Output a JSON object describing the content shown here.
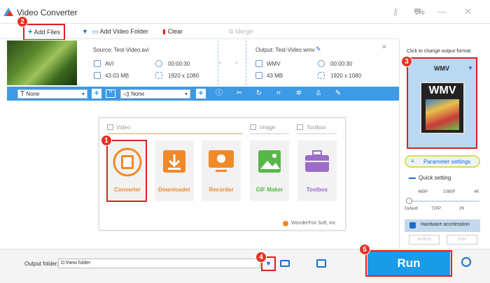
{
  "app": {
    "title": "Video Converter"
  },
  "toolbar": {
    "add_files": "Add Files",
    "add_video_folder": "Add Video Folder",
    "clear": "Clear",
    "merge": "Merge"
  },
  "file": {
    "source": "Source: Test-Video.avi",
    "output": "Output: Test-Video.wmv",
    "src_format": "AVI",
    "src_duration": "00:00:30",
    "src_size": "43.03 MB",
    "src_resolution": "1920 x 1080",
    "out_format": "WMV",
    "out_duration": "00:00:30",
    "out_size": "43 MB",
    "out_resolution": "1920 x 1080"
  },
  "edit": {
    "subtitle": "None",
    "audio": "None"
  },
  "panel": {
    "section_video": "Video",
    "section_image": "Image",
    "section_toolbox": "Toolbox",
    "cards": [
      {
        "label": "Converter",
        "icon": "film-reel-icon",
        "color": "#f0892a"
      },
      {
        "label": "Downloader",
        "icon": "download-icon",
        "color": "#f0892a"
      },
      {
        "label": "Recorder",
        "icon": "screen-record-icon",
        "color": "#f0892a"
      },
      {
        "label": "GIF Maker",
        "icon": "image-icon",
        "color": "#56b848"
      },
      {
        "label": "Toolbox",
        "icon": "toolbox-icon",
        "color": "#9b6cc9"
      }
    ],
    "brand": "WonderFox Soft, Inc."
  },
  "side": {
    "change_format": "Click to change output format:",
    "format": "WMV",
    "format_icon_text": "WMV",
    "param_settings": "Parameter settings",
    "quick_setting": "Quick setting",
    "ticks_top": [
      "480P",
      "1080P",
      "4K"
    ],
    "ticks_bottom": [
      "Default",
      "720P",
      "2K"
    ],
    "hw_accel": "Hardware acceleration",
    "nvidia": "NVIDIA",
    "intel": "Intel"
  },
  "bottom": {
    "output_folder_label": "Output folder:",
    "output_folder_value": "D:\\New folder",
    "run": "Run"
  },
  "badges": [
    "1",
    "2",
    "3",
    "4",
    "5"
  ],
  "colors": {
    "accent": "#3c9ae6",
    "run": "#1a9be8",
    "highlight": "#e02020",
    "badge": "#e63123"
  }
}
